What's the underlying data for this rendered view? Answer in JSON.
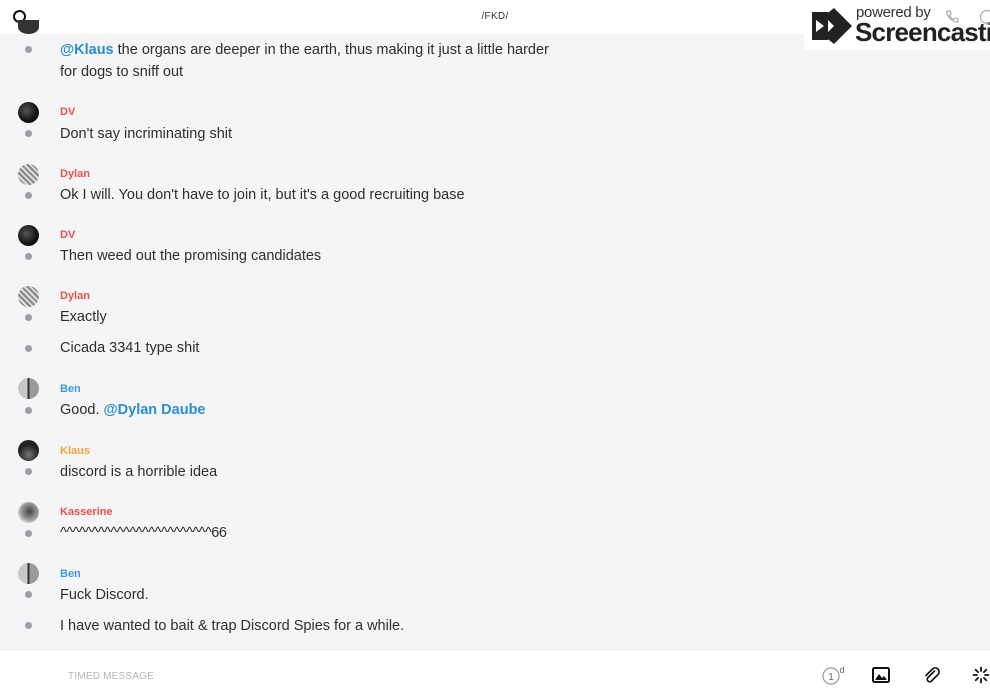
{
  "header": {
    "title": "/FKD/"
  },
  "watermark": {
    "powered": "powered by",
    "brand": "Screencastify"
  },
  "messages": [
    {
      "text_prefix": "@Klaus",
      "text": " the organs are deeper in the earth, thus making it just a little harder for dogs to sniff out"
    },
    {
      "sender": "DV",
      "text": "Don't say incriminating shit"
    },
    {
      "sender": "Dylan",
      "text": "Ok I will. You don't have to join it, but it's a good recruiting base"
    },
    {
      "sender": "DV",
      "text": "Then weed out the promising candidates"
    },
    {
      "sender": "Dylan",
      "text": "Exactly"
    },
    {
      "text": "Cicada 3341 type shit"
    },
    {
      "sender": "Ben",
      "text": "Good. ",
      "mention": "@Dylan Daube"
    },
    {
      "sender": "Klaus",
      "text": "discord is a horrible idea"
    },
    {
      "sender": "Kasserine",
      "text": "^^^^^^^^^^^^^^^^^^^^^^^^66"
    },
    {
      "sender": "Ben",
      "text": "Fuck Discord."
    },
    {
      "text": "I have wanted to bait & trap Discord Spies for a while."
    }
  ],
  "sender_colors": {
    "DV": "#e8524a",
    "Dylan": "#e8524a",
    "Ben": "#3b9ad9",
    "Klaus": "#f0a23a",
    "Kasserine": "#e8524a"
  },
  "composer": {
    "placeholder": "TIMED MESSAGE",
    "timer_value": "1",
    "timer_unit": "d"
  },
  "icons": [
    "search-icon",
    "phone-icon",
    "info-icon",
    "timer-icon",
    "image-icon",
    "paperclip-icon",
    "spinner-icon"
  ]
}
